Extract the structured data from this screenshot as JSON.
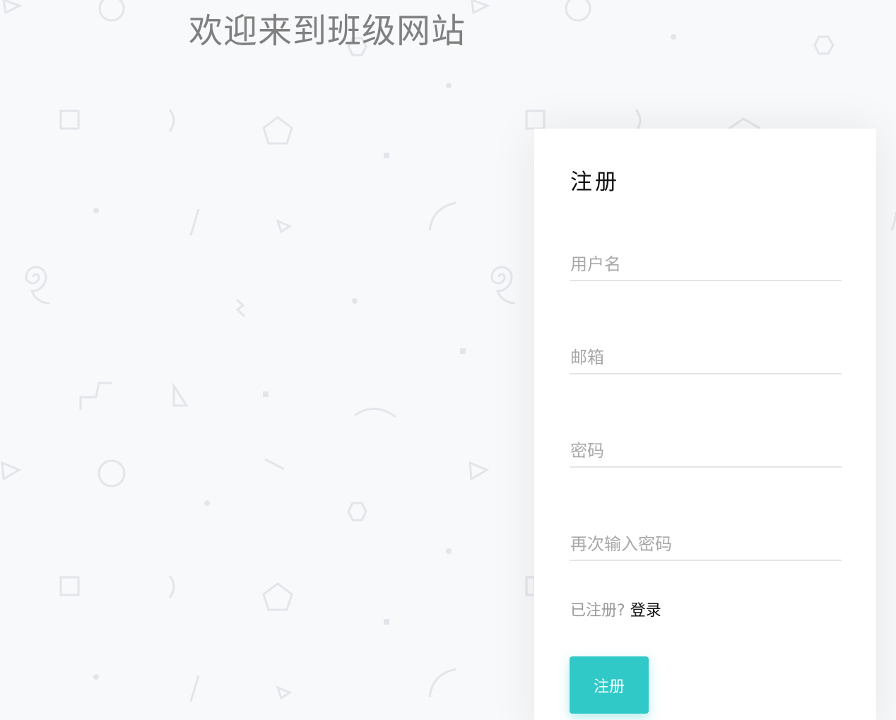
{
  "header": {
    "title": "欢迎来到班级网站"
  },
  "register": {
    "title": "注册",
    "fields": {
      "username": {
        "placeholder": "用户名",
        "value": ""
      },
      "email": {
        "placeholder": "邮箱",
        "value": ""
      },
      "password": {
        "placeholder": "密码",
        "value": ""
      },
      "confirm_password": {
        "placeholder": "再次输入密码",
        "value": ""
      }
    },
    "already_registered": "已注册?",
    "login_link": "登录",
    "submit_label": "注册"
  },
  "colors": {
    "accent": "#30c9c8",
    "background": "#f8f9fb",
    "pattern": "#e4e5ea"
  }
}
